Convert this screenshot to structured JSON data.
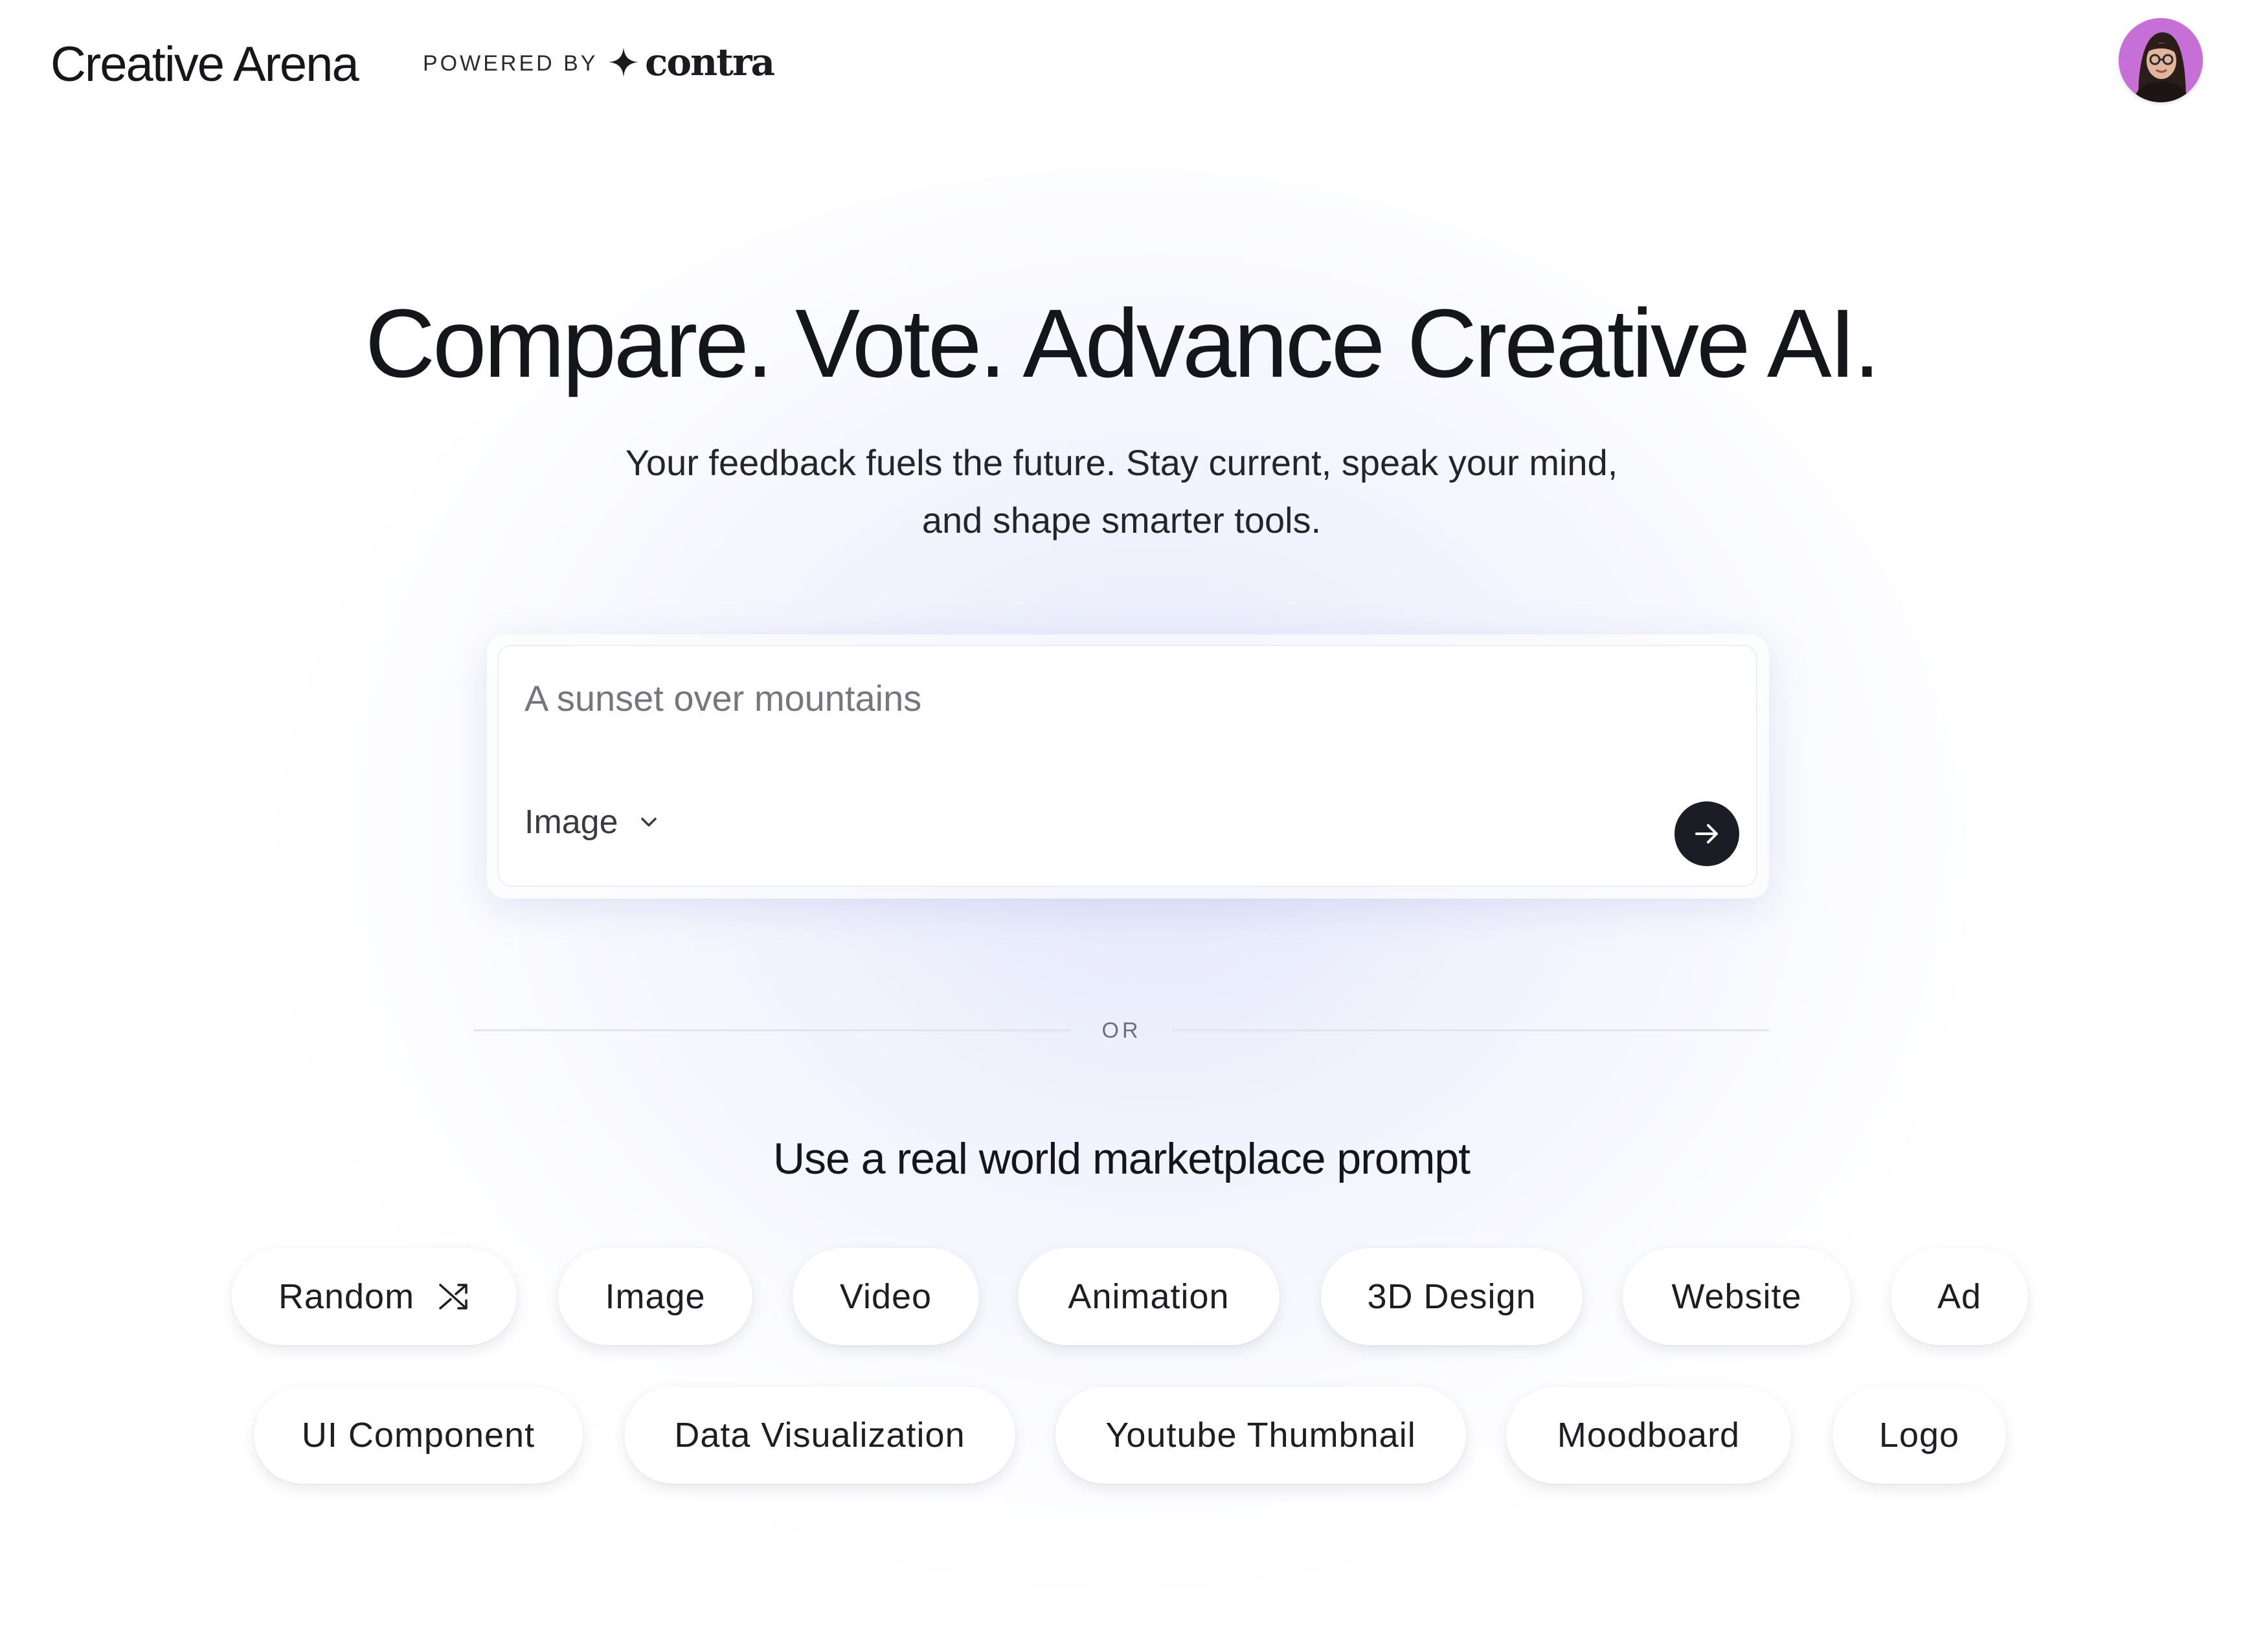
{
  "header": {
    "brand": "Creative Arena",
    "powered_by": "POWERED BY",
    "partner_name": "contra",
    "partner_icon": "four-point-star-icon",
    "avatar_icon": "user-avatar"
  },
  "hero": {
    "title": "Compare. Vote. Advance Creative AI.",
    "subtitle_line1": "Your feedback fuels the future. Stay current, speak your mind,",
    "subtitle_line2": "and shape smarter tools."
  },
  "prompt": {
    "placeholder": "A sunset over mountains",
    "value": "",
    "type_selected": "Image",
    "type_icon": "chevron-down-icon",
    "submit_icon": "arrow-right-icon"
  },
  "divider": {
    "text": "OR"
  },
  "marketplace": {
    "title": "Use a real world marketplace prompt",
    "random_icon": "shuffle-icon",
    "row1": [
      "Random",
      "Image",
      "Video",
      "Animation",
      "3D Design",
      "Website",
      "Ad"
    ],
    "row2": [
      "UI Component",
      "Data Visualization",
      "Youtube Thumbnail",
      "Moodboard",
      "Logo"
    ]
  },
  "colors": {
    "text": "#16171c",
    "muted": "#75767e",
    "submit_bg": "#1c1d24",
    "avatar_bg": "#c66fd6",
    "glow": "#dee3fa"
  }
}
